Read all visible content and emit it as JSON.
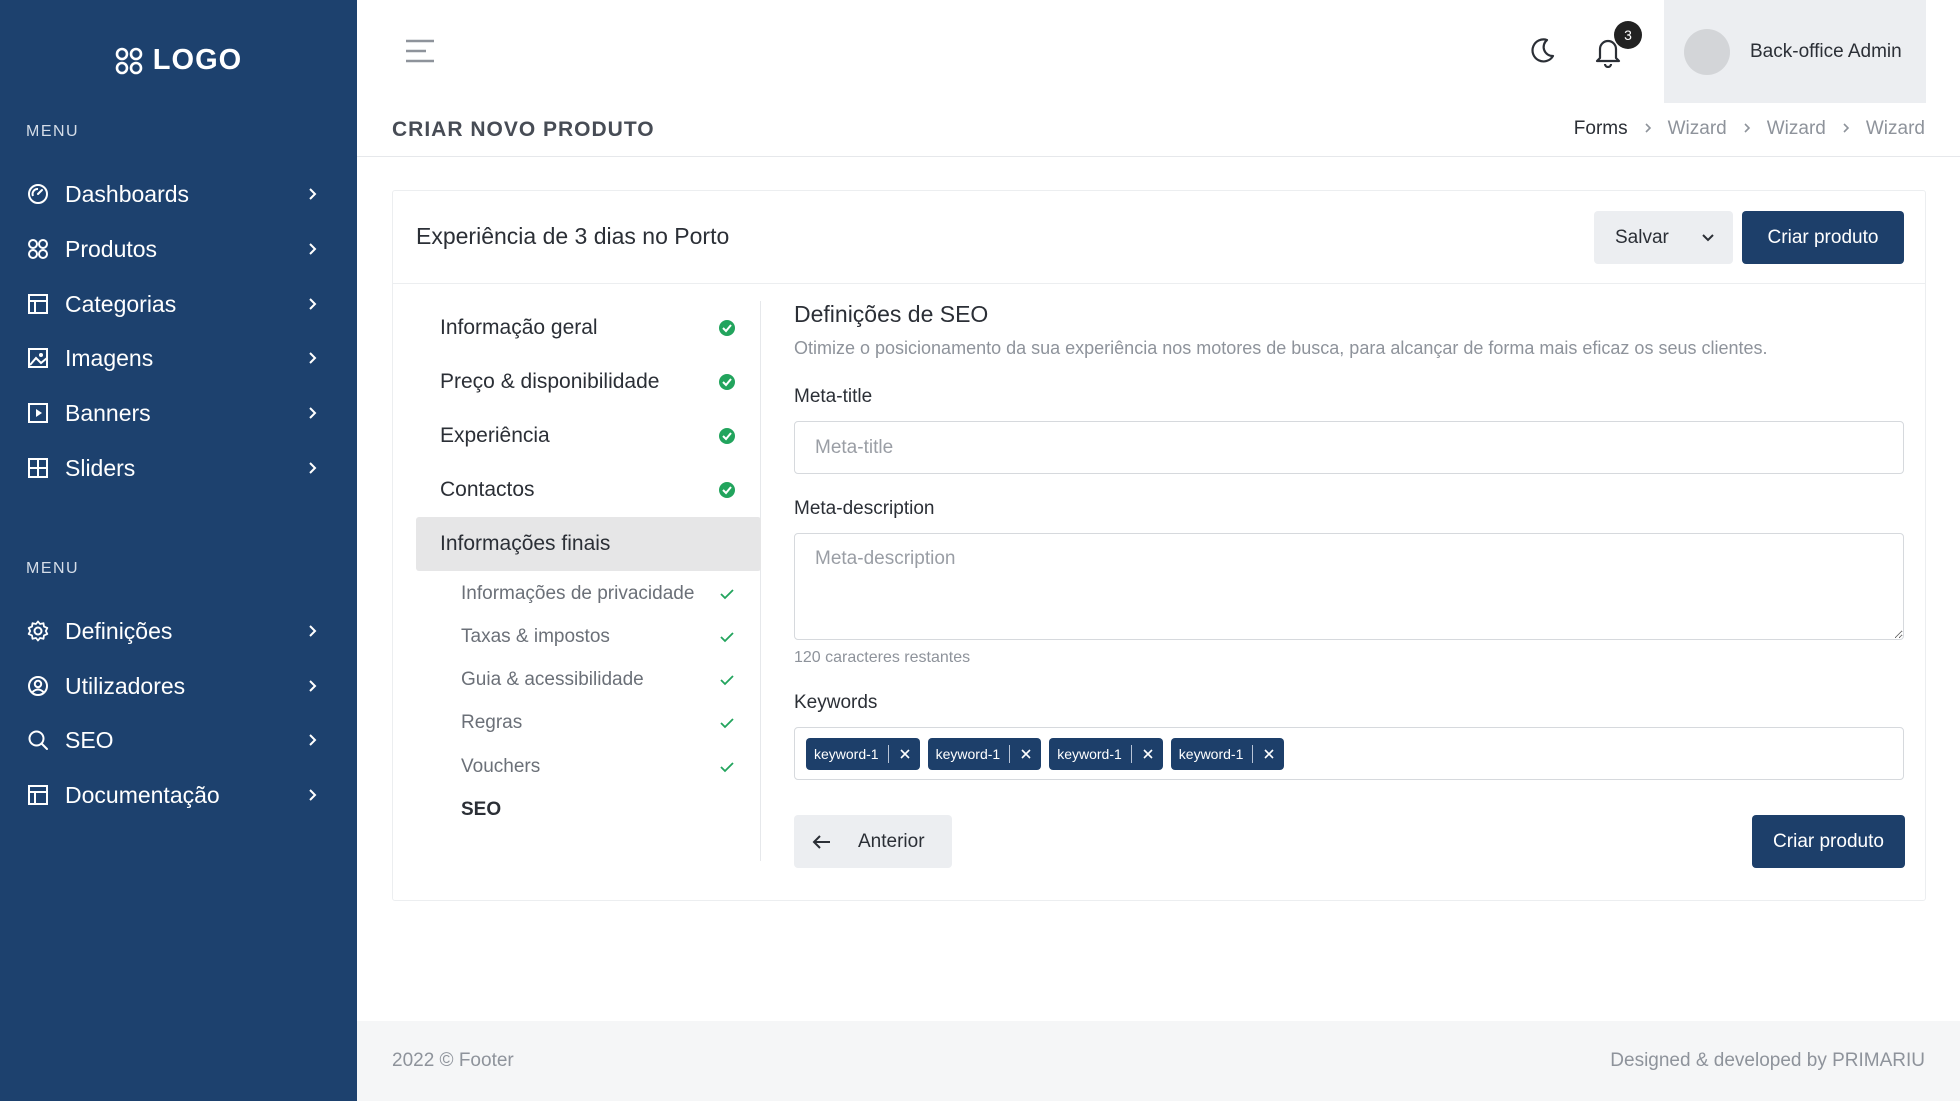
{
  "sidebar": {
    "logo_text": "LOGO",
    "menu_label_1": "MENU",
    "menu_label_2": "MENU",
    "items_primary": [
      {
        "label": "Dashboards",
        "icon": "gauge-icon"
      },
      {
        "label": "Produtos",
        "icon": "grid-circles-icon"
      },
      {
        "label": "Categorias",
        "icon": "layout-icon"
      },
      {
        "label": "Imagens",
        "icon": "image-icon"
      },
      {
        "label": "Banners",
        "icon": "play-square-icon"
      },
      {
        "label": "Sliders",
        "icon": "grid-square-icon"
      }
    ],
    "items_secondary": [
      {
        "label": "Definições",
        "icon": "gear-icon"
      },
      {
        "label": "Utilizadores",
        "icon": "user-circle-icon"
      },
      {
        "label": "SEO",
        "icon": "search-icon"
      },
      {
        "label": "Documentação",
        "icon": "layout-icon"
      }
    ]
  },
  "header": {
    "notification_count": "3",
    "user_name": "Back-office Admin"
  },
  "page": {
    "title": "CRIAR NOVO PRODUTO",
    "breadcrumb": [
      "Forms",
      "Wizard",
      "Wizard",
      "Wizard"
    ]
  },
  "card": {
    "title": "Experiência de 3 dias no Porto",
    "save_label": "Salvar",
    "create_label": "Criar produto"
  },
  "steps": [
    {
      "label": "Informação geral",
      "done": true
    },
    {
      "label": "Preço & disponibilidade",
      "done": true
    },
    {
      "label": "Experiência",
      "done": true
    },
    {
      "label": "Contactos",
      "done": true
    },
    {
      "label": "Informações finais",
      "active": true
    }
  ],
  "substeps": [
    {
      "label": "Informações de privacidade",
      "done": true
    },
    {
      "label": "Taxas & impostos",
      "done": true
    },
    {
      "label": "Guia & acessibilidade",
      "done": true
    },
    {
      "label": "Regras",
      "done": true
    },
    {
      "label": "Vouchers",
      "done": true
    },
    {
      "label": "SEO",
      "current": true
    }
  ],
  "form": {
    "title": "Definições de SEO",
    "description": "Otimize o posicionamento da sua experiência nos motores de busca, para alcançar de forma mais eficaz os seus clientes.",
    "meta_title_label": "Meta-title",
    "meta_title_placeholder": "Meta-title",
    "meta_title_value": "",
    "meta_description_label": "Meta-description",
    "meta_description_placeholder": "Meta-description",
    "meta_description_value": "",
    "chars_remaining": "120 caracteres restantes",
    "keywords_label": "Keywords",
    "keywords": [
      "keyword-1",
      "keyword-1",
      "keyword-1",
      "keyword-1"
    ],
    "prev_label": "Anterior",
    "create_label": "Criar produto"
  },
  "footer": {
    "left": "2022 © Footer",
    "right": "Designed & developed by PRIMARIU"
  },
  "colors": {
    "sidebar_bg": "#1d416e",
    "primary": "#1d3f6a",
    "success": "#22a45d"
  }
}
